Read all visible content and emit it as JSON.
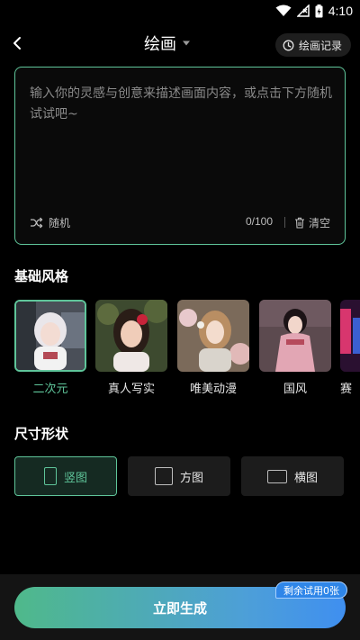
{
  "status_bar": {
    "time": "4:10"
  },
  "header": {
    "title": "绘画",
    "history_label": "绘画记录"
  },
  "prompt": {
    "placeholder": "输入你的灵感与创意来描述画面内容，或点击下方随机试试吧~",
    "random_label": "随机",
    "counter": "0/100",
    "clear_label": "清空"
  },
  "styles": {
    "title": "基础风格",
    "items": [
      {
        "label": "二次元",
        "selected": true
      },
      {
        "label": "真人写实"
      },
      {
        "label": "唯美动漫"
      },
      {
        "label": "国风"
      },
      {
        "label": "赛"
      }
    ]
  },
  "sizes": {
    "title": "尺寸形状",
    "items": [
      {
        "label": "竖图",
        "selected": true
      },
      {
        "label": "方图"
      },
      {
        "label": "横图"
      }
    ]
  },
  "generate": {
    "label": "立即生成",
    "badge": "剩余试用0张"
  },
  "colors": {
    "accent": "#5fc59a",
    "blue": "#3f8ff0",
    "background": "#000000"
  }
}
